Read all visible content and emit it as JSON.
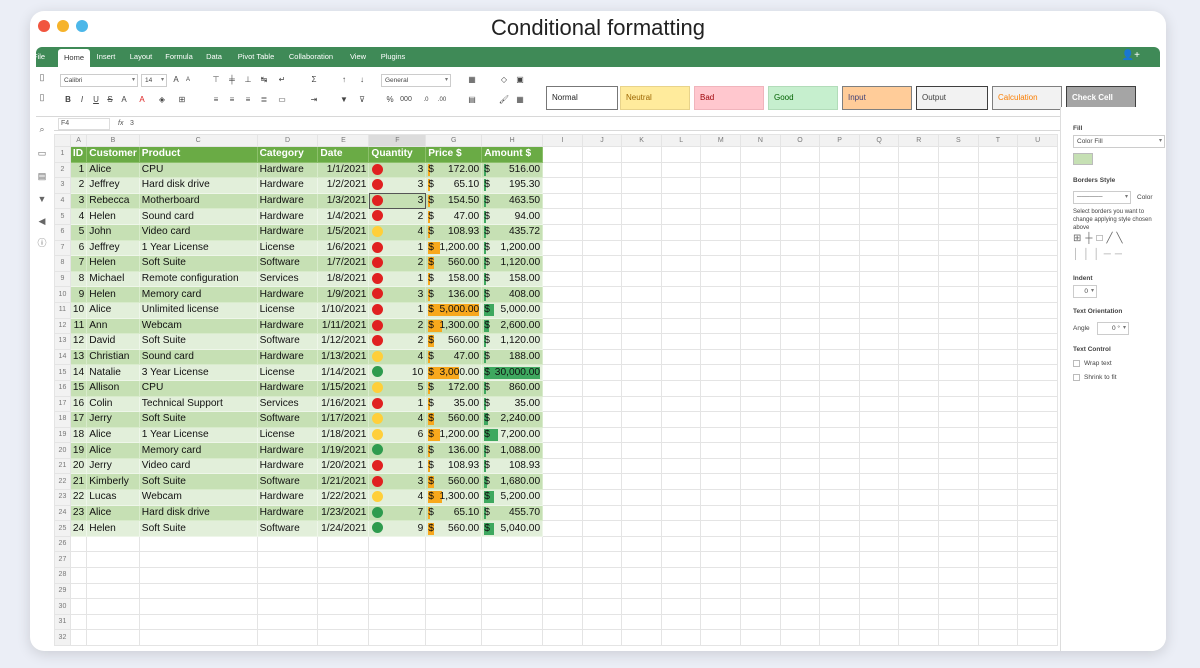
{
  "window": {
    "title": "Conditional formatting"
  },
  "menu": {
    "items": [
      "File",
      "Home",
      "Insert",
      "Layout",
      "Formula",
      "Data",
      "Pivot Table",
      "Collaboration",
      "View",
      "Plugins"
    ],
    "active": "Home"
  },
  "ribbon": {
    "font_name": "Calibri",
    "font_size": "14",
    "number_format": "General",
    "styles": [
      {
        "label": "Normal",
        "bg": "#ffffff",
        "fg": "#222222",
        "border": "#777777"
      },
      {
        "label": "Neutral",
        "bg": "#ffeb9c",
        "fg": "#9c6500",
        "border": "#e8d38a"
      },
      {
        "label": "Bad",
        "bg": "#ffc7ce",
        "fg": "#9c0006",
        "border": "#f0b4bc"
      },
      {
        "label": "Good",
        "bg": "#c6efce",
        "fg": "#006100",
        "border": "#b2dcb9"
      },
      {
        "label": "Input",
        "bg": "#ffcc99",
        "fg": "#3f3f76",
        "border": "#7f7f7f"
      },
      {
        "label": "Output",
        "bg": "#f2f2f2",
        "fg": "#3f3f3f",
        "border": "#3f3f3f"
      },
      {
        "label": "Calculation",
        "bg": "#f2f2f2",
        "fg": "#fa7d00",
        "border": "#7f7f7f"
      },
      {
        "label": "Check Cell",
        "bg": "#a5a5a5",
        "fg": "#ffffff",
        "border": "#3f3f3f"
      }
    ]
  },
  "formula_bar": {
    "cell_ref": "F4",
    "fx": "fx",
    "value": "3"
  },
  "sheet": {
    "columns": [
      "A",
      "B",
      "C",
      "D",
      "E",
      "F",
      "G",
      "H",
      "I",
      "J",
      "K",
      "L",
      "M",
      "N",
      "O",
      "P",
      "Q",
      "R",
      "S",
      "T",
      "U"
    ],
    "headers": [
      "ID",
      "Customer",
      "Product",
      "Category",
      "Date",
      "Quantity",
      "Price $",
      "Amount $"
    ],
    "rows": [
      {
        "id": "1",
        "customer": "Alice",
        "product": "CPU",
        "category": "Hardware",
        "date": "1/1/2021",
        "quantity": 3,
        "price": "172.00",
        "amount": "516.00"
      },
      {
        "id": "2",
        "customer": "Jeffrey",
        "product": "Hard disk drive",
        "category": "Hardware",
        "date": "1/2/2021",
        "quantity": 3,
        "price": "65.10",
        "amount": "195.30"
      },
      {
        "id": "3",
        "customer": "Rebecca",
        "product": "Motherboard",
        "category": "Hardware",
        "date": "1/3/2021",
        "quantity": 3,
        "price": "154.50",
        "amount": "463.50"
      },
      {
        "id": "4",
        "customer": "Helen",
        "product": "Sound card",
        "category": "Hardware",
        "date": "1/4/2021",
        "quantity": 2,
        "price": "47.00",
        "amount": "94.00"
      },
      {
        "id": "5",
        "customer": "John",
        "product": "Video card",
        "category": "Hardware",
        "date": "1/5/2021",
        "quantity": 4,
        "price": "108.93",
        "amount": "435.72"
      },
      {
        "id": "6",
        "customer": "Jeffrey",
        "product": "1 Year License",
        "category": "License",
        "date": "1/6/2021",
        "quantity": 1,
        "price": "1,200.00",
        "amount": "1,200.00"
      },
      {
        "id": "7",
        "customer": "Helen",
        "product": "Soft Suite",
        "category": "Software",
        "date": "1/7/2021",
        "quantity": 2,
        "price": "560.00",
        "amount": "1,120.00"
      },
      {
        "id": "8",
        "customer": "Michael",
        "product": "Remote configuration",
        "category": "Services",
        "date": "1/8/2021",
        "quantity": 1,
        "price": "158.00",
        "amount": "158.00"
      },
      {
        "id": "9",
        "customer": "Helen",
        "product": "Memory card",
        "category": "Hardware",
        "date": "1/9/2021",
        "quantity": 3,
        "price": "136.00",
        "amount": "408.00"
      },
      {
        "id": "10",
        "customer": "Alice",
        "product": "Unlimited license",
        "category": "License",
        "date": "1/10/2021",
        "quantity": 1,
        "price": "5,000.00",
        "amount": "5,000.00"
      },
      {
        "id": "11",
        "customer": "Ann",
        "product": "Webcam",
        "category": "Hardware",
        "date": "1/11/2021",
        "quantity": 2,
        "price": "1,300.00",
        "amount": "2,600.00"
      },
      {
        "id": "12",
        "customer": "David",
        "product": "Soft Suite",
        "category": "Software",
        "date": "1/12/2021",
        "quantity": 2,
        "price": "560.00",
        "amount": "1,120.00"
      },
      {
        "id": "13",
        "customer": "Christian",
        "product": "Sound card",
        "category": "Hardware",
        "date": "1/13/2021",
        "quantity": 4,
        "price": "47.00",
        "amount": "188.00"
      },
      {
        "id": "14",
        "customer": "Natalie",
        "product": "3 Year License",
        "category": "License",
        "date": "1/14/2021",
        "quantity": 10,
        "price": "3,000.00",
        "amount": "30,000.00"
      },
      {
        "id": "15",
        "customer": "Allison",
        "product": "CPU",
        "category": "Hardware",
        "date": "1/15/2021",
        "quantity": 5,
        "price": "172.00",
        "amount": "860.00"
      },
      {
        "id": "16",
        "customer": "Colin",
        "product": "Technical Support",
        "category": "Services",
        "date": "1/16/2021",
        "quantity": 1,
        "price": "35.00",
        "amount": "35.00"
      },
      {
        "id": "17",
        "customer": "Jerry",
        "product": "Soft Suite",
        "category": "Software",
        "date": "1/17/2021",
        "quantity": 4,
        "price": "560.00",
        "amount": "2,240.00"
      },
      {
        "id": "18",
        "customer": "Alice",
        "product": "1 Year License",
        "category": "License",
        "date": "1/18/2021",
        "quantity": 6,
        "price": "1,200.00",
        "amount": "7,200.00"
      },
      {
        "id": "19",
        "customer": "Alice",
        "product": "Memory card",
        "category": "Hardware",
        "date": "1/19/2021",
        "quantity": 8,
        "price": "136.00",
        "amount": "1,088.00"
      },
      {
        "id": "20",
        "customer": "Jerry",
        "product": "Video card",
        "category": "Hardware",
        "date": "1/20/2021",
        "quantity": 1,
        "price": "108.93",
        "amount": "108.93"
      },
      {
        "id": "21",
        "customer": "Kimberly",
        "product": "Soft Suite",
        "category": "Software",
        "date": "1/21/2021",
        "quantity": 3,
        "price": "560.00",
        "amount": "1,680.00"
      },
      {
        "id": "22",
        "customer": "Lucas",
        "product": "Webcam",
        "category": "Hardware",
        "date": "1/22/2021",
        "quantity": 4,
        "price": "1,300.00",
        "amount": "5,200.00"
      },
      {
        "id": "23",
        "customer": "Alice",
        "product": "Hard disk drive",
        "category": "Hardware",
        "date": "1/23/2021",
        "quantity": 7,
        "price": "65.10",
        "amount": "455.70"
      },
      {
        "id": "24",
        "customer": "Helen",
        "product": "Soft Suite",
        "category": "Software",
        "date": "1/24/2021",
        "quantity": 9,
        "price": "560.00",
        "amount": "5,040.00"
      }
    ],
    "empty_rows": 10,
    "currency_symbol": "$",
    "price_max": 5000,
    "amount_max": 30000,
    "colors": {
      "red": "#e02020",
      "yellow": "#ffcf3a",
      "green": "#2e9b4e",
      "price_bar": "#f8a81c",
      "amount_bar": "#3ea85f"
    }
  },
  "panel": {
    "fill_title": "Fill",
    "fill_type": "Color Fill",
    "fill_color": "#c6e0b4",
    "borders_title": "Borders Style",
    "border_color_label": "Color",
    "borders_hint": "Select borders you want to change applying style chosen above",
    "indent_title": "Indent",
    "indent_value": "0",
    "orientation_title": "Text Orientation",
    "angle_label": "Angle",
    "angle_value": "0 °",
    "control_title": "Text Control",
    "wrap_label": "Wrap text",
    "shrink_label": "Shrink to fit"
  }
}
